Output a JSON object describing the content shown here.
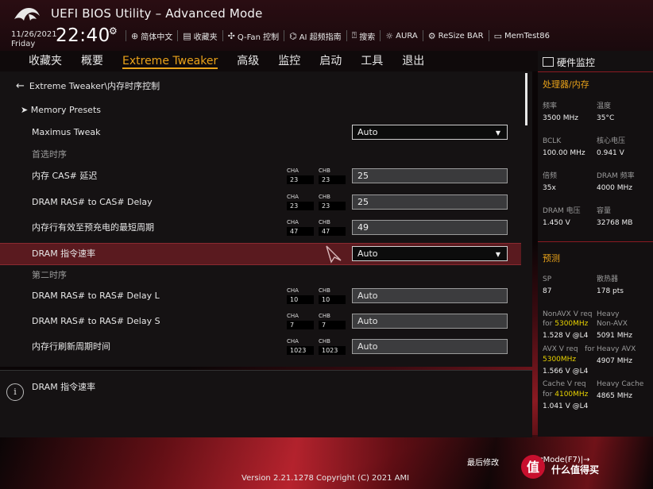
{
  "header": {
    "title": "UEFI BIOS Utility – Advanced Mode",
    "date": "11/26/2021",
    "day": "Friday",
    "time": "22:40",
    "tools": [
      {
        "icon": "globe-icon",
        "label": "简体中文"
      },
      {
        "icon": "bookmark-icon",
        "label": "收藏夹"
      },
      {
        "icon": "fan-icon",
        "label": "Q-Fan 控制"
      },
      {
        "icon": "ai-icon",
        "label": "AI 超频指南"
      },
      {
        "icon": "help-icon",
        "label": "搜索"
      },
      {
        "icon": "aura-icon",
        "label": "AURA"
      },
      {
        "icon": "resize-bar-icon",
        "label": "ReSize BAR"
      },
      {
        "icon": "memtest-icon",
        "label": "MemTest86"
      }
    ]
  },
  "menu": [
    {
      "label": "收藏夹"
    },
    {
      "label": "概要"
    },
    {
      "label": "Extreme Tweaker",
      "active": true
    },
    {
      "label": "高级"
    },
    {
      "label": "监控"
    },
    {
      "label": "启动"
    },
    {
      "label": "工具"
    },
    {
      "label": "退出"
    }
  ],
  "main": {
    "breadcrumb": "Extreme Tweaker\\内存时序控制",
    "presets": "Memory Presets",
    "maximus_label": "Maximus Tweak",
    "maximus_value": "Auto",
    "section_primary": "首选时序",
    "section_secondary": "第二时序",
    "rows": [
      {
        "label": "内存 CAS# 延迟",
        "cha": "23",
        "chb": "23",
        "value": "25"
      },
      {
        "label": "DRAM RAS# to CAS# Delay",
        "cha": "23",
        "chb": "23",
        "value": "25"
      },
      {
        "label": "内存行有效至预充电的最短周期",
        "cha": "47",
        "chb": "47",
        "value": "49"
      },
      {
        "label": "DRAM 指令速率",
        "value": "Auto"
      },
      {
        "label": "DRAM RAS# to RAS# Delay L",
        "cha": "10",
        "chb": "10",
        "value": "Auto"
      },
      {
        "label": "DRAM RAS# to RAS# Delay S",
        "cha": "7",
        "chb": "7",
        "value": "Auto"
      },
      {
        "label": "内存行刷新周期时间",
        "cha": "1023",
        "chb": "1023",
        "value": "Auto"
      }
    ],
    "ch_a": "CHA",
    "ch_b": "CHB"
  },
  "help": {
    "text": "DRAM 指令速率"
  },
  "hw": {
    "title": "硬件监控",
    "cpu_mem": "处理器/内存",
    "freq_label": "频率",
    "freq": "3500 MHz",
    "temp_label": "温度",
    "temp": "35°C",
    "bclk_label": "BCLK",
    "bclk": "100.00 MHz",
    "vcore_label": "核心电压",
    "vcore": "0.941 V",
    "ratio_label": "倍频",
    "ratio": "35x",
    "dram_freq_label": "DRAM 频率",
    "dram_freq": "4000 MHz",
    "dram_v_label": "DRAM 电压",
    "dram_v": "1.450 V",
    "cap_label": "容量",
    "cap": "32768 MB",
    "predict": "预测",
    "sp_label": "SP",
    "sp": "87",
    "cooler_label": "散热器",
    "cooler": "178 pts",
    "nonavx_label": "NonAVX V req",
    "nonavx_for": "for",
    "nonavx_freq": "5300MHz",
    "nonavx_v": "1.528 V @L4",
    "heavy_nonavx_label1": "Heavy",
    "heavy_nonavx_label2": "Non-AVX",
    "heavy_nonavx": "5091 MHz",
    "avx_label": "AVX V req",
    "avx_for": "for",
    "avx_freq": "5300MHz",
    "avx_v": "1.566 V @L4",
    "heavy_avx_label": "Heavy AVX",
    "heavy_avx": "4907 MHz",
    "cache_label": "Cache V req",
    "cache_for": "for",
    "cache_freq": "4100MHz",
    "cache_v": "1.041 V @L4",
    "heavy_cache_label": "Heavy Cache",
    "heavy_cache": "4865 MHz"
  },
  "footer": {
    "last_modified": "最后修改",
    "ez_mode": "EzMode(F7)|→",
    "version": "Version 2.21.1278 Copyright (C) 2021 AMI",
    "watermark": "什么值得买"
  }
}
